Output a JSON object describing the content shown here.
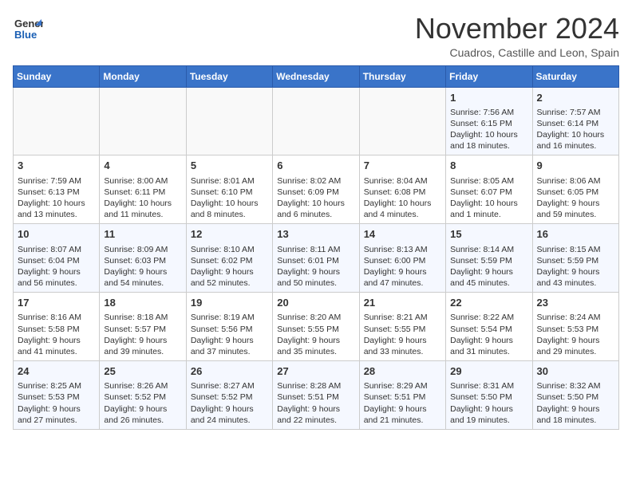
{
  "header": {
    "logo_line1": "General",
    "logo_line2": "Blue",
    "month": "November 2024",
    "location": "Cuadros, Castille and Leon, Spain"
  },
  "days_of_week": [
    "Sunday",
    "Monday",
    "Tuesday",
    "Wednesday",
    "Thursday",
    "Friday",
    "Saturday"
  ],
  "weeks": [
    [
      {
        "day": "",
        "info": ""
      },
      {
        "day": "",
        "info": ""
      },
      {
        "day": "",
        "info": ""
      },
      {
        "day": "",
        "info": ""
      },
      {
        "day": "",
        "info": ""
      },
      {
        "day": "1",
        "info": "Sunrise: 7:56 AM\nSunset: 6:15 PM\nDaylight: 10 hours and 18 minutes."
      },
      {
        "day": "2",
        "info": "Sunrise: 7:57 AM\nSunset: 6:14 PM\nDaylight: 10 hours and 16 minutes."
      }
    ],
    [
      {
        "day": "3",
        "info": "Sunrise: 7:59 AM\nSunset: 6:13 PM\nDaylight: 10 hours and 13 minutes."
      },
      {
        "day": "4",
        "info": "Sunrise: 8:00 AM\nSunset: 6:11 PM\nDaylight: 10 hours and 11 minutes."
      },
      {
        "day": "5",
        "info": "Sunrise: 8:01 AM\nSunset: 6:10 PM\nDaylight: 10 hours and 8 minutes."
      },
      {
        "day": "6",
        "info": "Sunrise: 8:02 AM\nSunset: 6:09 PM\nDaylight: 10 hours and 6 minutes."
      },
      {
        "day": "7",
        "info": "Sunrise: 8:04 AM\nSunset: 6:08 PM\nDaylight: 10 hours and 4 minutes."
      },
      {
        "day": "8",
        "info": "Sunrise: 8:05 AM\nSunset: 6:07 PM\nDaylight: 10 hours and 1 minute."
      },
      {
        "day": "9",
        "info": "Sunrise: 8:06 AM\nSunset: 6:05 PM\nDaylight: 9 hours and 59 minutes."
      }
    ],
    [
      {
        "day": "10",
        "info": "Sunrise: 8:07 AM\nSunset: 6:04 PM\nDaylight: 9 hours and 56 minutes."
      },
      {
        "day": "11",
        "info": "Sunrise: 8:09 AM\nSunset: 6:03 PM\nDaylight: 9 hours and 54 minutes."
      },
      {
        "day": "12",
        "info": "Sunrise: 8:10 AM\nSunset: 6:02 PM\nDaylight: 9 hours and 52 minutes."
      },
      {
        "day": "13",
        "info": "Sunrise: 8:11 AM\nSunset: 6:01 PM\nDaylight: 9 hours and 50 minutes."
      },
      {
        "day": "14",
        "info": "Sunrise: 8:13 AM\nSunset: 6:00 PM\nDaylight: 9 hours and 47 minutes."
      },
      {
        "day": "15",
        "info": "Sunrise: 8:14 AM\nSunset: 5:59 PM\nDaylight: 9 hours and 45 minutes."
      },
      {
        "day": "16",
        "info": "Sunrise: 8:15 AM\nSunset: 5:59 PM\nDaylight: 9 hours and 43 minutes."
      }
    ],
    [
      {
        "day": "17",
        "info": "Sunrise: 8:16 AM\nSunset: 5:58 PM\nDaylight: 9 hours and 41 minutes."
      },
      {
        "day": "18",
        "info": "Sunrise: 8:18 AM\nSunset: 5:57 PM\nDaylight: 9 hours and 39 minutes."
      },
      {
        "day": "19",
        "info": "Sunrise: 8:19 AM\nSunset: 5:56 PM\nDaylight: 9 hours and 37 minutes."
      },
      {
        "day": "20",
        "info": "Sunrise: 8:20 AM\nSunset: 5:55 PM\nDaylight: 9 hours and 35 minutes."
      },
      {
        "day": "21",
        "info": "Sunrise: 8:21 AM\nSunset: 5:55 PM\nDaylight: 9 hours and 33 minutes."
      },
      {
        "day": "22",
        "info": "Sunrise: 8:22 AM\nSunset: 5:54 PM\nDaylight: 9 hours and 31 minutes."
      },
      {
        "day": "23",
        "info": "Sunrise: 8:24 AM\nSunset: 5:53 PM\nDaylight: 9 hours and 29 minutes."
      }
    ],
    [
      {
        "day": "24",
        "info": "Sunrise: 8:25 AM\nSunset: 5:53 PM\nDaylight: 9 hours and 27 minutes."
      },
      {
        "day": "25",
        "info": "Sunrise: 8:26 AM\nSunset: 5:52 PM\nDaylight: 9 hours and 26 minutes."
      },
      {
        "day": "26",
        "info": "Sunrise: 8:27 AM\nSunset: 5:52 PM\nDaylight: 9 hours and 24 minutes."
      },
      {
        "day": "27",
        "info": "Sunrise: 8:28 AM\nSunset: 5:51 PM\nDaylight: 9 hours and 22 minutes."
      },
      {
        "day": "28",
        "info": "Sunrise: 8:29 AM\nSunset: 5:51 PM\nDaylight: 9 hours and 21 minutes."
      },
      {
        "day": "29",
        "info": "Sunrise: 8:31 AM\nSunset: 5:50 PM\nDaylight: 9 hours and 19 minutes."
      },
      {
        "day": "30",
        "info": "Sunrise: 8:32 AM\nSunset: 5:50 PM\nDaylight: 9 hours and 18 minutes."
      }
    ]
  ]
}
